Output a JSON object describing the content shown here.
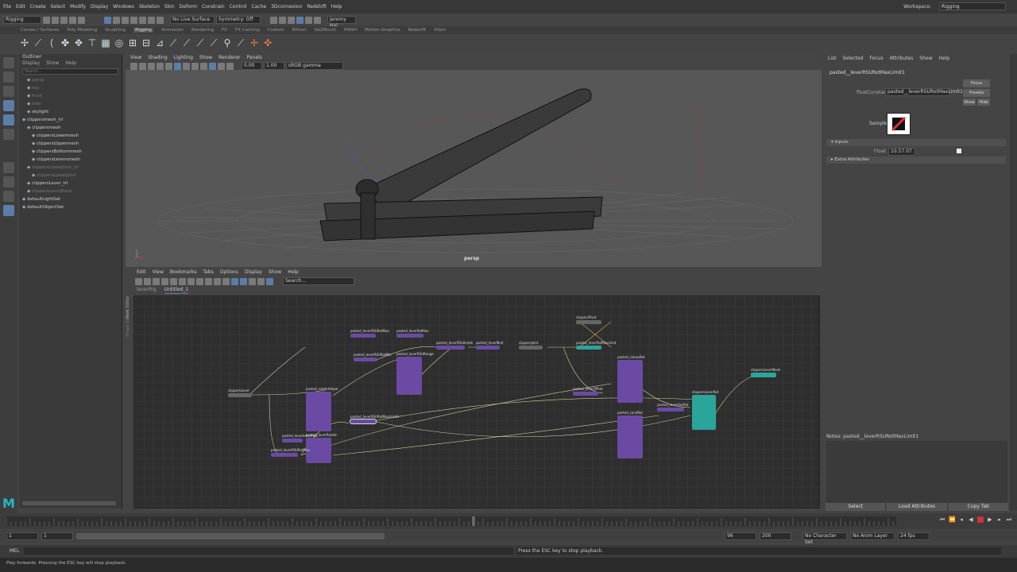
{
  "menubar": {
    "items": [
      "File",
      "Edit",
      "Create",
      "Select",
      "Modify",
      "Display",
      "Windows",
      "Skeleton",
      "Skin",
      "Deform",
      "Constrain",
      "Control",
      "Cache",
      "3Dconnexion",
      "Redshift",
      "Help"
    ],
    "workspace_label": "Workspace:",
    "workspace_value": "Rigging"
  },
  "statusline": {
    "mode": "Rigging",
    "live_surface": "No Live Surface",
    "symmetry": "Symmetry: Off",
    "user": "Jeremy Hal..."
  },
  "shelf_tabs": [
    "Curves / Surfaces",
    "Poly Modeling",
    "Sculpting",
    "Rigging",
    "Animation",
    "Rendering",
    "FX",
    "FX Caching",
    "Custom",
    "Bifrost",
    "GoZBrush",
    "MASH",
    "Motion Graphics",
    "Redshift",
    "XGen"
  ],
  "shelf_active_tab": "Rigging",
  "outliner": {
    "title": "Outliner",
    "menu": [
      "Display",
      "Show",
      "Help"
    ],
    "search_placeholder": "Search...",
    "items": [
      {
        "label": "persp",
        "dim": true
      },
      {
        "label": "top",
        "dim": true
      },
      {
        "label": "front",
        "dim": true
      },
      {
        "label": "side",
        "dim": true
      },
      {
        "label": "skylight",
        "dim": false
      },
      {
        "label": "clippersmesh_trl",
        "dim": false
      },
      {
        "label": "clippersmesh",
        "dim": false
      },
      {
        "label": "clippersLowermesh",
        "dim": false
      },
      {
        "label": "clippersUppermesh",
        "dim": false
      },
      {
        "label": "clippersBottommesh",
        "dim": false
      },
      {
        "label": "clippersLeversmesh",
        "dim": false
      },
      {
        "label": "clippersLowerJoint_trl",
        "dim": true
      },
      {
        "label": "clippersLowerJoint",
        "dim": true
      },
      {
        "label": "clippersLever_trl",
        "dim": false
      },
      {
        "label": "clippersLeverBase",
        "dim": true
      },
      {
        "label": "defaultLightSet",
        "dim": false
      },
      {
        "label": "defaultObjectSet",
        "dim": false
      }
    ]
  },
  "viewport": {
    "menu": [
      "View",
      "Shading",
      "Lighting",
      "Show",
      "Renderer",
      "Panels"
    ],
    "camera_label": "persp",
    "exposure": "0.00",
    "gamma": "1.00",
    "color_space": "sRGB gamma"
  },
  "node_editor": {
    "menu": [
      "Edit",
      "View",
      "Bookmarks",
      "Tabs",
      "Options",
      "Display",
      "Show",
      "Help"
    ],
    "search_placeholder": "Search...",
    "tabs": [
      "leverRig",
      "Untitled_1"
    ],
    "active_tab": "Untitled_1",
    "side_labels": [
      "Node Editor",
      "Shape Editor"
    ]
  },
  "attribute_editor": {
    "menu": [
      "List",
      "Selected",
      "Focus",
      "Attributes",
      "Show",
      "Help"
    ],
    "node_name": "pasted__leverRSURotMaxLimit1",
    "node_field_label": "floatConstant:",
    "node_field_value": "pasted__leverRSURotMaxLimit1",
    "buttons": [
      "Focus",
      "Presets",
      "Show",
      "Hide"
    ],
    "sample_label": "Sample",
    "inputs_section": "Inputs",
    "float_label": "Float",
    "float_value": "10.57.07",
    "extra_section": "Extra Attributes",
    "notes_label": "Notes: pasted__leverRSURotMaxLimit1",
    "bottom_buttons": [
      "Select",
      "Load Attributes",
      "Copy Tab"
    ]
  },
  "timeline": {
    "start": "1",
    "end": "1",
    "range_start": "96",
    "range_end": "200",
    "character_set": "No Character Set",
    "anim_layer": "No Anim Layer",
    "fps": "24 fps"
  },
  "command_line": {
    "lang": "MEL",
    "result": "Press the ESC key to stop playback."
  },
  "help_line": "Play forwards. Pressing the ESC key will stop playback."
}
